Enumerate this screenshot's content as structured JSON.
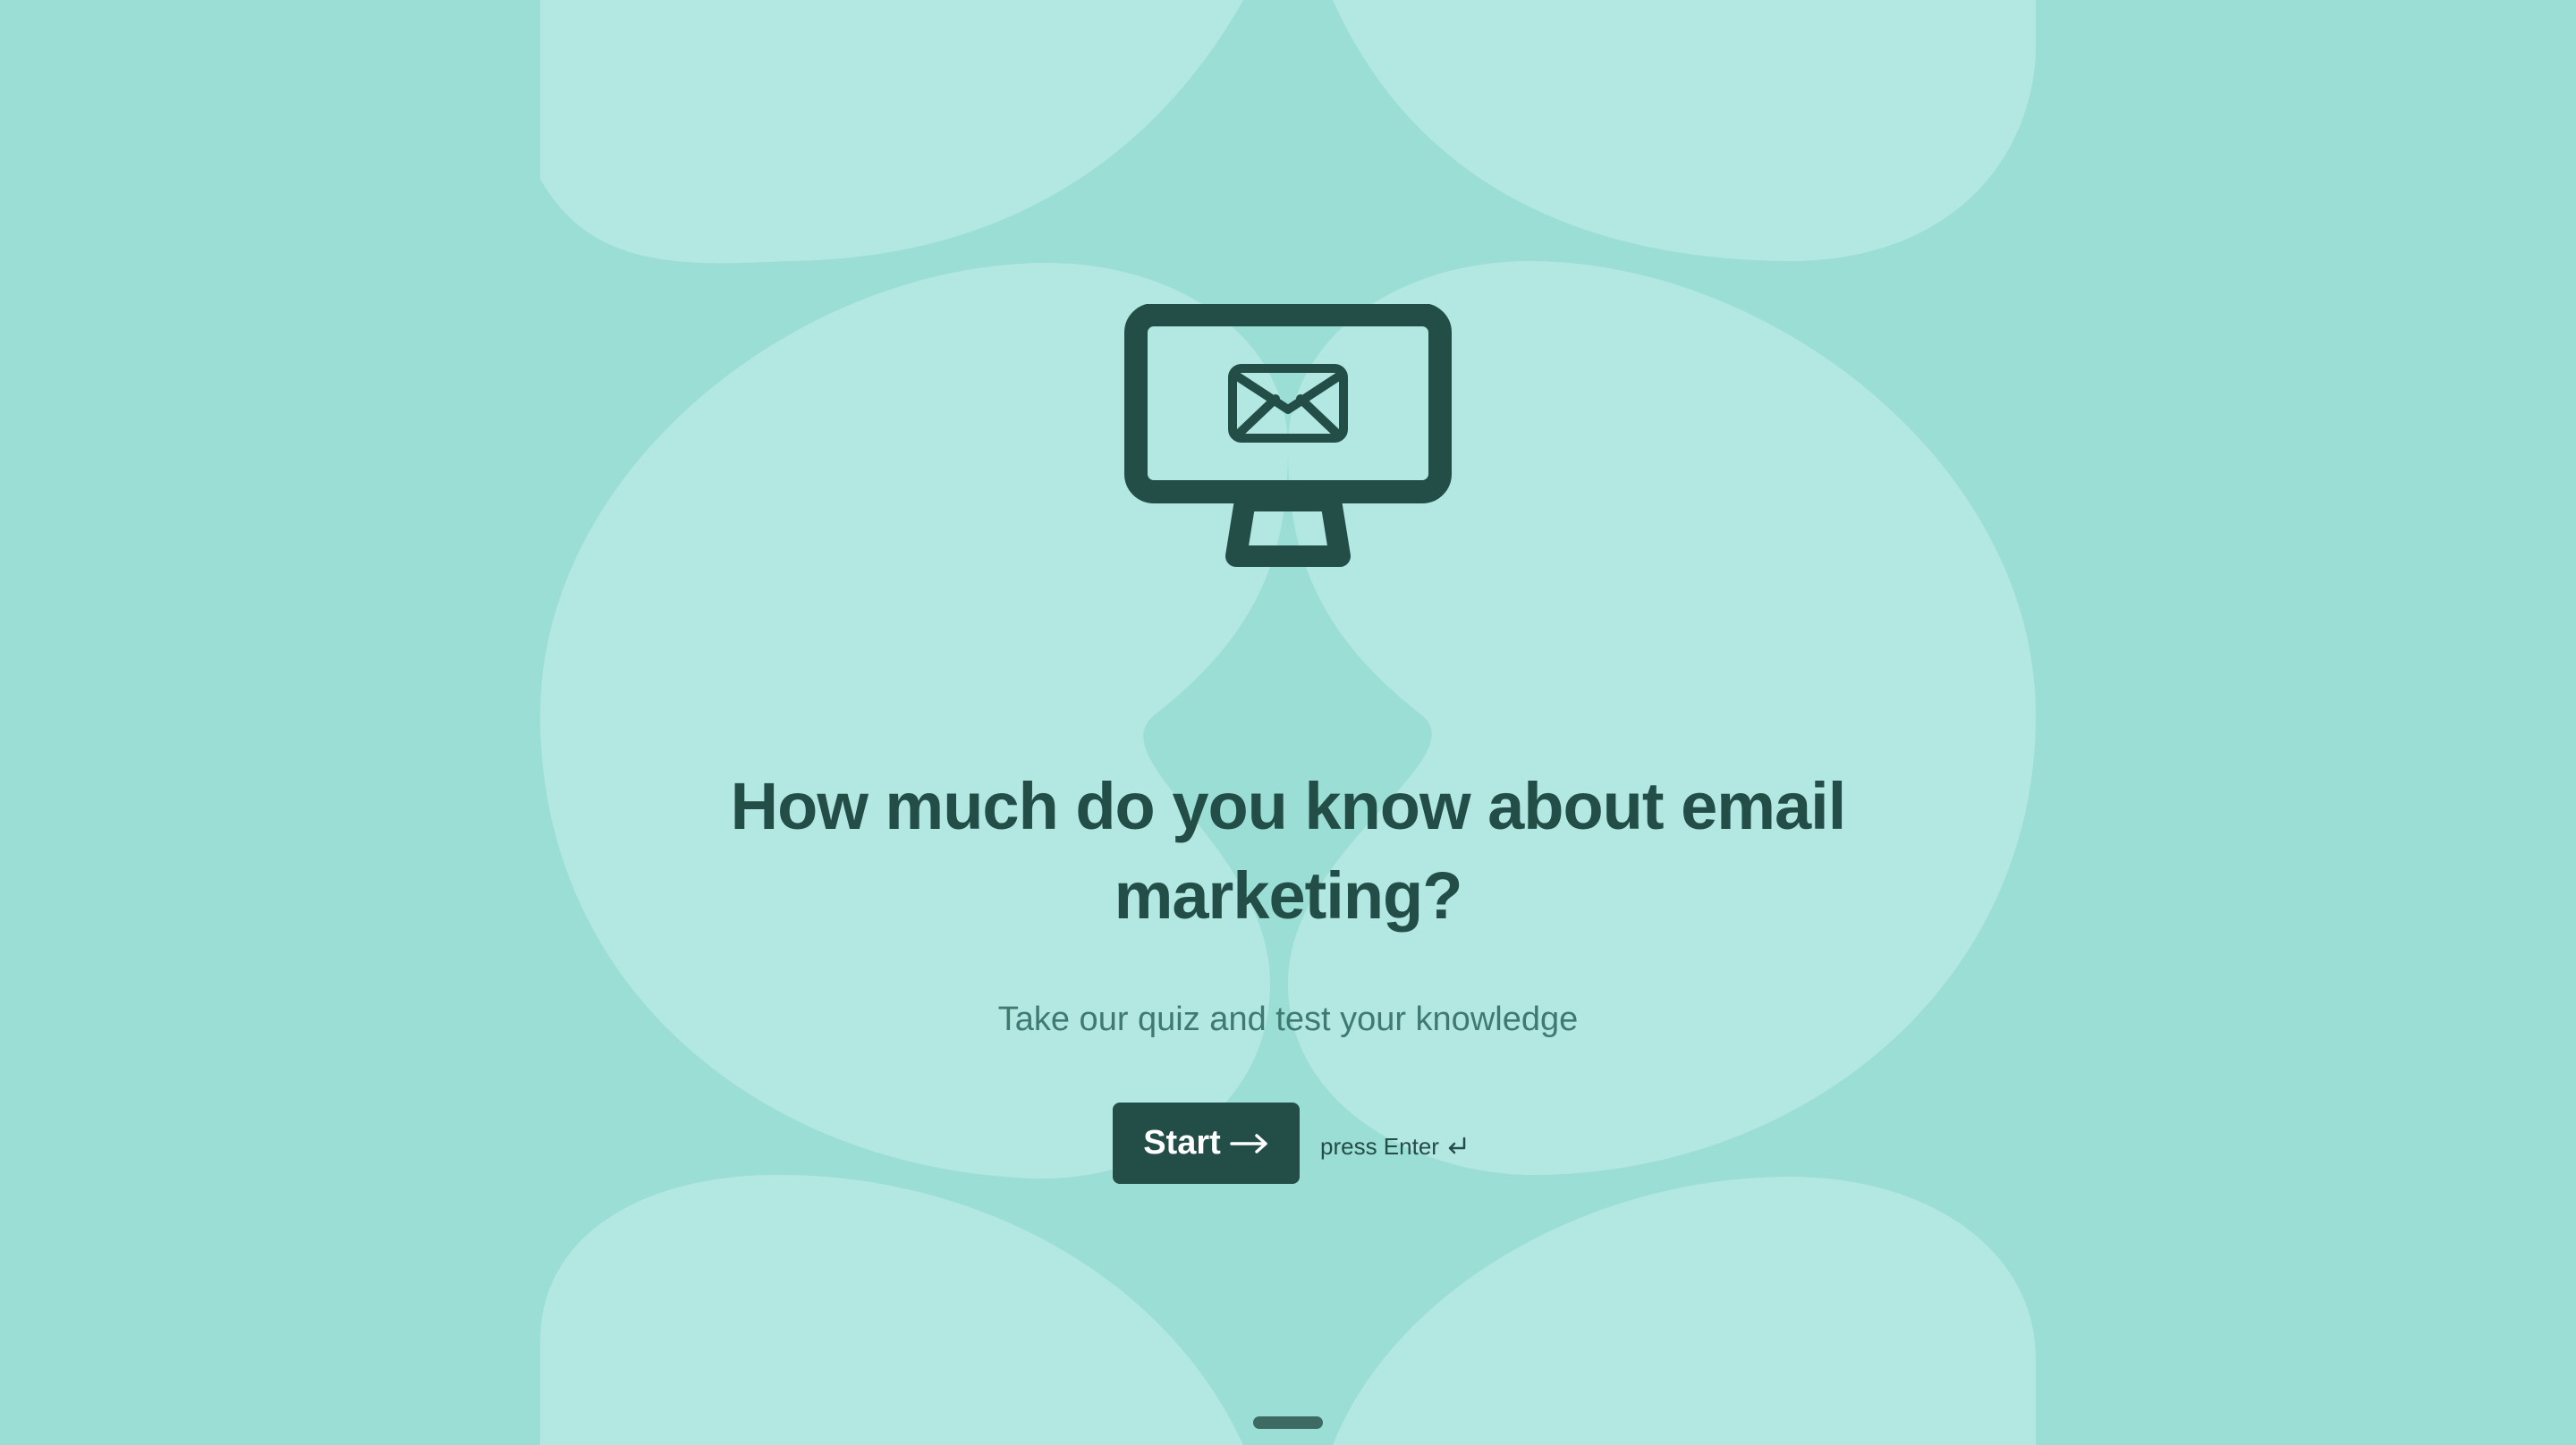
{
  "hero": {
    "icon": "monitor-mail-icon",
    "title": "How much do you know about email marketing?",
    "subtitle": "Take our quiz and test your knowledge"
  },
  "actions": {
    "start_label": "Start",
    "start_icon": "arrow-right-icon",
    "hint_label": "press Enter",
    "hint_icon": "enter-key-icon"
  },
  "colors": {
    "background": "#9bded5",
    "shape": "#b3e7e2",
    "primary": "#234e47",
    "subtitle": "#3f7a70"
  }
}
